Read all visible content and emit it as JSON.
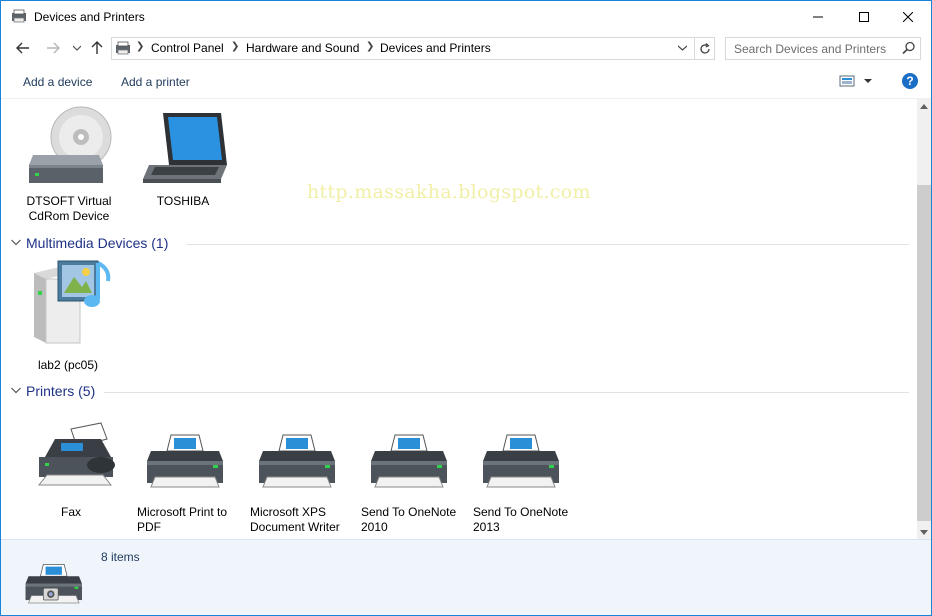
{
  "window": {
    "title": "Devices and Printers"
  },
  "address": {
    "crumbs": [
      "Control Panel",
      "Hardware and Sound",
      "Devices and Printers"
    ]
  },
  "search": {
    "placeholder": "Search Devices and Printers"
  },
  "toolbar": {
    "add_device": "Add a device",
    "add_printer": "Add a printer",
    "help": "?"
  },
  "watermark": "http.massakha.blogspot.com",
  "devices": [
    {
      "label_line1": "DTSOFT Virtual",
      "label_line2": "CdRom Device",
      "icon": "cd-drive-icon"
    },
    {
      "label_line1": "TOSHIBA",
      "label_line2": "",
      "icon": "laptop-icon"
    }
  ],
  "groups": {
    "multimedia": {
      "title": "Multimedia Devices (1)"
    },
    "printers": {
      "title": "Printers (5)"
    }
  },
  "multimedia": [
    {
      "label_line1": "lab2 (pc05)",
      "icon": "media-server-icon"
    }
  ],
  "printers": [
    {
      "label_line1": "Fax",
      "label_line2": "",
      "icon": "fax-icon"
    },
    {
      "label_line1": "Microsoft Print to",
      "label_line2": "PDF",
      "icon": "printer-icon"
    },
    {
      "label_line1": "Microsoft XPS",
      "label_line2": "Document Writer",
      "icon": "printer-icon"
    },
    {
      "label_line1": "Send To OneNote",
      "label_line2": "2010",
      "icon": "printer-icon"
    },
    {
      "label_line1": "Send To OneNote",
      "label_line2": "2013",
      "icon": "printer-icon"
    }
  ],
  "details": {
    "count": "8 items"
  },
  "colors": {
    "accent": "#1883d7",
    "group_title": "#1e3287",
    "link": "#1e395b",
    "details_bg": "#f0f5fb"
  }
}
